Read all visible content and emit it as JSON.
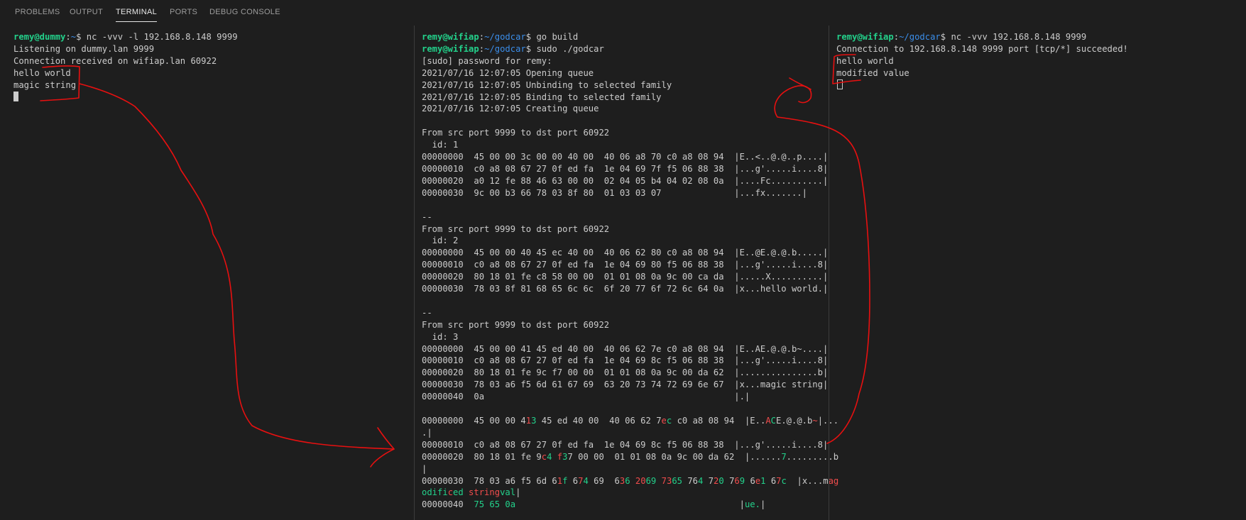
{
  "tabs": [
    "PROBLEMS",
    "OUTPUT",
    "TERMINAL",
    "PORTS",
    "DEBUG CONSOLE"
  ],
  "active_tab": "TERMINAL",
  "colors": {
    "background": "#1e1e1e",
    "user_green": "#23d18b",
    "path_blue": "#3b8eea",
    "annotation_red": "#e81010",
    "diff_red": "#f14c4c",
    "diff_green": "#23d18b"
  },
  "left": {
    "prompt1": {
      "user": "remy@dummy",
      "path": "~",
      "command": "nc -vvv -l 192.168.8.148 9999"
    },
    "output": [
      "Listening on dummy.lan 9999",
      "Connection received on wifiap.lan 60922",
      "hello world",
      "magic string"
    ]
  },
  "middle": {
    "prompt1": {
      "user": "remy@wifiap",
      "path": "~/godcar",
      "command": "go build"
    },
    "prompt2": {
      "user": "remy@wifiap",
      "path": "~/godcar",
      "command": "sudo ./godcar"
    },
    "log": [
      "[sudo] password for remy:",
      "2021/07/16 12:07:05 Opening queue",
      "2021/07/16 12:07:05 Unbinding to selected family",
      "2021/07/16 12:07:05 Binding to selected family",
      "2021/07/16 12:07:05 Creating queue"
    ],
    "packets": [
      {
        "header": "From src port 9999 to dst port 60922",
        "id": "  id: 1",
        "rows": [
          "00000000  45 00 00 3c 00 00 40 00  40 06 a8 70 c0 a8 08 94  |E..<..@.@..p....|",
          "00000010  c0 a8 08 67 27 0f ed fa  1e 04 69 7f f5 06 88 38  |...g'.....i....8|",
          "00000020  a0 12 fe 88 46 63 00 00  02 04 05 b4 04 02 08 0a  |....Fc..........|",
          "00000030  9c 00 b3 66 78 03 8f 80  01 03 03 07              |...fx.......|"
        ]
      },
      {
        "header": "From src port 9999 to dst port 60922",
        "id": "  id: 2",
        "rows": [
          "00000000  45 00 00 40 45 ec 40 00  40 06 62 80 c0 a8 08 94  |E..@E.@.@.b.....|",
          "00000010  c0 a8 08 67 27 0f ed fa  1e 04 69 80 f5 06 88 38  |...g'.....i....8|",
          "00000020  80 18 01 fe c8 58 00 00  01 01 08 0a 9c 00 ca da  |.....X..........|",
          "00000030  78 03 8f 81 68 65 6c 6c  6f 20 77 6f 72 6c 64 0a  |x...hello world.|"
        ]
      },
      {
        "header": "From src port 9999 to dst port 60922",
        "id": "  id: 3",
        "rows": [
          "00000000  45 00 00 41 45 ed 40 00  40 06 62 7e c0 a8 08 94  |E..AE.@.@.b~....|",
          "00000010  c0 a8 08 67 27 0f ed fa  1e 04 69 8c f5 06 88 38  |...g'.....i....8|",
          "00000020  80 18 01 fe 9c f7 00 00  01 01 08 0a 9c 00 da 62  |...............b|",
          "00000030  78 03 a6 f5 6d 61 67 69  63 20 73 74 72 69 6e 67  |x...magic string|",
          "00000040  0a                                                |.|"
        ]
      }
    ],
    "separator": "--",
    "diff": {
      "row0": {
        "a": "00000000  45 00 00 4",
        "r1": "1",
        "g1": "3",
        "b": " 45 ed 40 00  40 06 62 7",
        "r2": "e",
        "g2": "c",
        "c": " c0 a8 08 94  |E..",
        "r3": "A",
        "g3": "C",
        "d": "E.@.@.b",
        "r4": "~",
        "e": "|...",
        "f": "."
      },
      "row1": "00000010  c0 a8 08 67 27 0f ed fa  1e 04 69 8c f5 06 88 38  |...g'.....i....8|",
      "row2": {
        "a": "00000020  80 18 01 fe 9",
        "r1": "c",
        "g1": "4",
        "b": " ",
        "r2": "f",
        "g2": "3",
        "c": "7 00 00  01 01 08 0a 9c 00 da 62  |......",
        "g3": "7",
        "d": ".........b",
        "e": "|"
      },
      "row3": "00000030  78 03 a6 f5 6d 61 67 69  63 20 73 74 72 69 6e 67  |x...m",
      "row3_tail": "odified stringval|",
      "row4": {
        "addr": "00000040",
        "hex": "75 65 0a",
        "ascii": "ue."
      }
    }
  },
  "right": {
    "prompt1": {
      "user": "remy@wifiap",
      "path": "~/godcar",
      "command": "nc -vvv 192.168.8.148 9999"
    },
    "output": [
      "Connection to 192.168.8.148 9999 port [tcp/*] succeeded!",
      "hello world",
      "modified value"
    ]
  }
}
